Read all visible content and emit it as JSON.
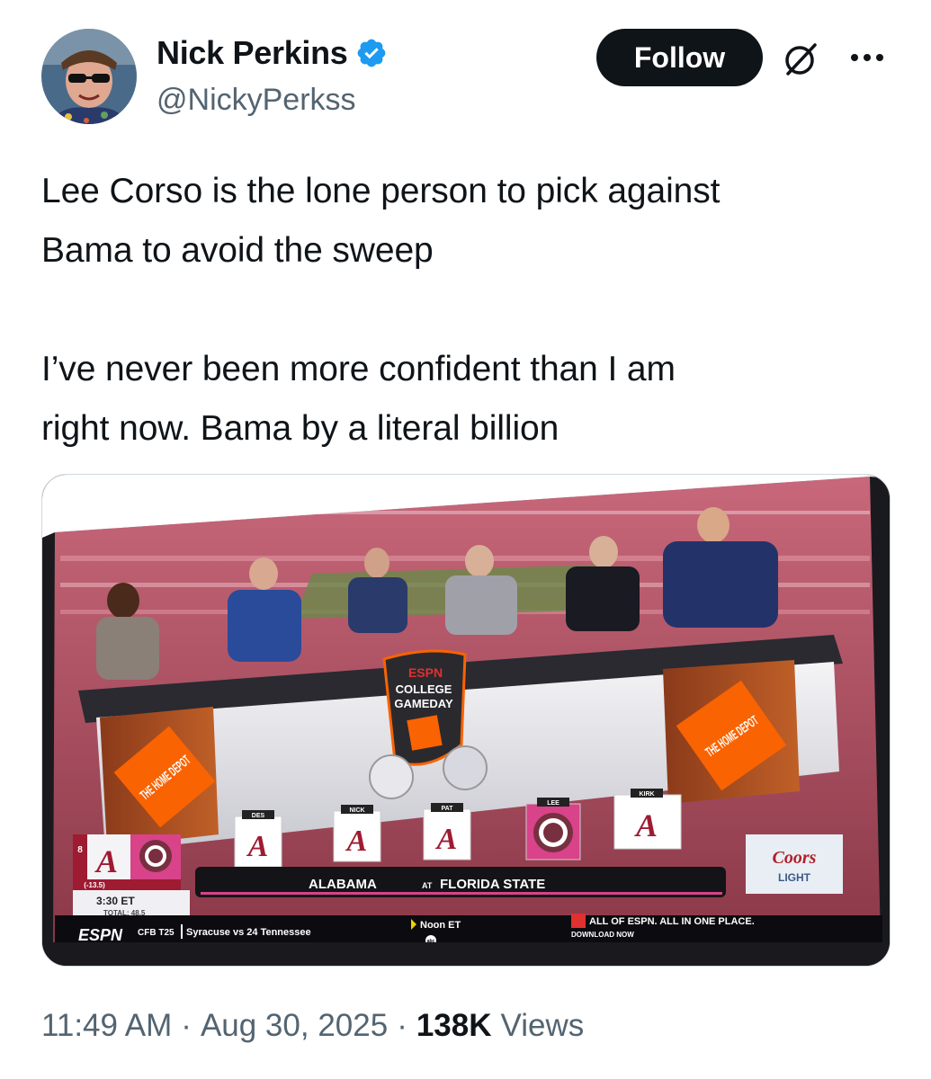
{
  "author": {
    "name": "Nick Perkins",
    "handle": "@NickyPerkss",
    "verified": true,
    "avatar_icon": "profile-photo"
  },
  "actions": {
    "follow_label": "Follow",
    "grok_icon": "grok-icon",
    "more_icon": "more-options-icon"
  },
  "tweet": {
    "text": "Lee Corso is the lone person to pick against\nBama to avoid the sweep\n\nI’ve never been more confident than I am\nright now. Bama by a literal billion"
  },
  "media": {
    "espn_logo": "ESPN",
    "show_title_1": "COLLEGE",
    "show_title_2": "GAMEDAY",
    "sponsor_left": "THE HOME DEPOT",
    "sponsor_right": "THE HOME DEPOT",
    "pick_labels": [
      "DES",
      "NICK",
      "PAT",
      "LEE",
      "KIRK"
    ],
    "spread": "(-13.5)",
    "game_time": "3:30 ET",
    "total": "TOTAL: 48.5",
    "matchup": "ALABAMA",
    "at": "AT",
    "matchup_2": "FLORIDA STATE",
    "coors_1": "Coors",
    "coors_2": "LIGHT",
    "ticker_espn": "ESPN",
    "ticker_text": "CFB T25",
    "ticker_game": "Syracuse vs 24 Tennessee",
    "ticker_time": "Noon ET",
    "ticker_network": "abc",
    "promo": "ALL OF ESPN. ALL IN ONE PLACE.",
    "promo_sub": "DOWNLOAD NOW",
    "team_a_rank": "8",
    "colors": {
      "crimson": "#9e1b32",
      "fsu_garnet": "#782f40",
      "home_depot_orange": "#f96302"
    }
  },
  "meta": {
    "time": "11:49 AM",
    "date": "Aug 30, 2025",
    "views_count": "138K",
    "views_label": "Views"
  },
  "theme": {
    "verified_blue": "#1d9bf0",
    "secondary_text": "#536471"
  }
}
